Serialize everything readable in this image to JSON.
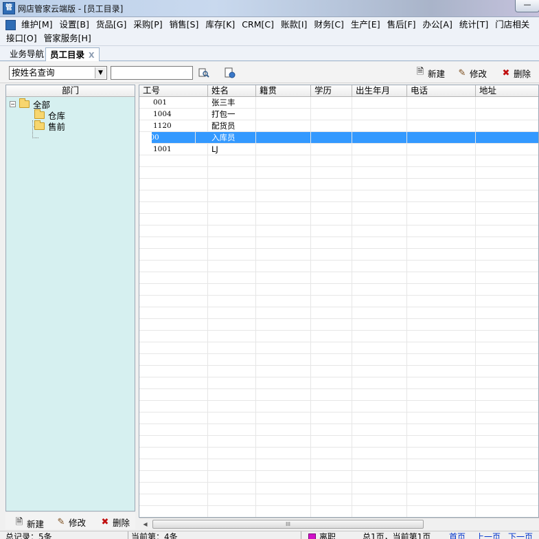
{
  "window": {
    "title": "网店管家云端版 - [员工目录]",
    "app_icon_glyph": "管",
    "minimize_glyph": "—"
  },
  "menu": {
    "row1": [
      "维护[M]",
      "设置[B]",
      "货品[G]",
      "采购[P]",
      "销售[S]",
      "库存[K]",
      "CRM[C]",
      "账款[I]",
      "财务[C]",
      "生产[E]",
      "售后[F]",
      "办公[A]",
      "统计[T]",
      "门店相关"
    ],
    "row2": [
      "接口[O]",
      "管家服务[H]"
    ]
  },
  "tabs": [
    {
      "label": "业务导航",
      "active": false
    },
    {
      "label": "员工目录",
      "active": true,
      "close": "X"
    }
  ],
  "toolbar": {
    "search_mode": "按姓名查询",
    "search_value": "",
    "new_label": "新建",
    "edit_label": "修改",
    "delete_label": "删除"
  },
  "dept_panel": {
    "header": "部门",
    "tree": {
      "root": "全部",
      "children": [
        "仓库",
        "售前"
      ]
    },
    "new_label": "新建",
    "edit_label": "修改",
    "delete_label": "删除"
  },
  "table": {
    "columns": [
      "工号",
      "姓名",
      "籍贯",
      "学历",
      "出生年月",
      "电话",
      "地址"
    ],
    "rows": [
      {
        "id": "001",
        "name": "张三丰",
        "hometown": "",
        "education": "",
        "birth": "",
        "phone": "",
        "address": ""
      },
      {
        "id": "1004",
        "name": "打包一",
        "hometown": "",
        "education": "",
        "birth": "",
        "phone": "",
        "address": ""
      },
      {
        "id": "1120",
        "name": "配货员",
        "hometown": "",
        "education": "",
        "birth": "",
        "phone": "",
        "address": ""
      },
      {
        "id": "1100",
        "name": "入库员",
        "hometown": "",
        "education": "",
        "birth": "",
        "phone": "",
        "address": "",
        "selected": true
      },
      {
        "id": "1001",
        "name": "LJ",
        "hometown": "",
        "education": "",
        "birth": "",
        "phone": "",
        "address": ""
      }
    ],
    "selected_color": "#3399ff"
  },
  "scrollbar": {
    "thumb_grip": "III"
  },
  "status": {
    "total_records": "总记录：5条",
    "current": "当前第：4条",
    "legend_label": "离职",
    "legend_color": "#d010c8",
    "pages": "总1页，当前第1页",
    "first_page": "首页",
    "prev_page": "上一页",
    "next_page": "下一页"
  },
  "colors": {
    "dept_panel_bg": "#d6f0f0",
    "delete_icon": "#c01010"
  }
}
